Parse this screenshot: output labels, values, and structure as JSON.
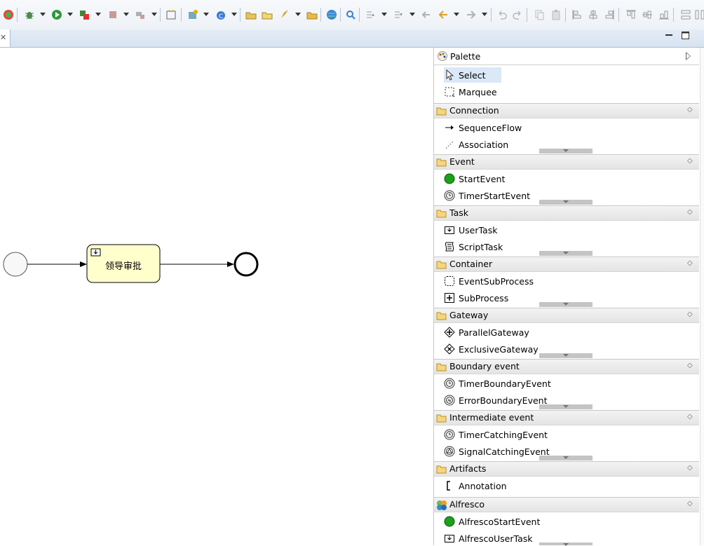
{
  "editor": {
    "close_glyph": "✕"
  },
  "diagram": {
    "user_task_label": "领导审批"
  },
  "palette": {
    "title": "Palette",
    "tools": [
      {
        "label": "Select",
        "icon": "select-arrow-icon"
      },
      {
        "label": "Marquee",
        "icon": "marquee-icon"
      }
    ],
    "drawers": [
      {
        "title": "Connection",
        "items": [
          {
            "label": "SequenceFlow",
            "icon": "sequence-flow-icon"
          },
          {
            "label": "Association",
            "icon": "association-icon"
          }
        ]
      },
      {
        "title": "Event",
        "items": [
          {
            "label": "StartEvent",
            "icon": "start-event-icon"
          },
          {
            "label": "TimerStartEvent",
            "icon": "timer-start-event-icon"
          }
        ]
      },
      {
        "title": "Task",
        "items": [
          {
            "label": "UserTask",
            "icon": "user-task-icon"
          },
          {
            "label": "ScriptTask",
            "icon": "script-task-icon"
          }
        ]
      },
      {
        "title": "Container",
        "items": [
          {
            "label": "EventSubProcess",
            "icon": "event-subprocess-icon"
          },
          {
            "label": "SubProcess",
            "icon": "subprocess-icon"
          }
        ]
      },
      {
        "title": "Gateway",
        "items": [
          {
            "label": "ParallelGateway",
            "icon": "parallel-gateway-icon"
          },
          {
            "label": "ExclusiveGateway",
            "icon": "exclusive-gateway-icon"
          }
        ]
      },
      {
        "title": "Boundary event",
        "items": [
          {
            "label": "TimerBoundaryEvent",
            "icon": "timer-boundary-event-icon"
          },
          {
            "label": "ErrorBoundaryEvent",
            "icon": "error-boundary-event-icon"
          }
        ]
      },
      {
        "title": "Intermediate event",
        "items": [
          {
            "label": "TimerCatchingEvent",
            "icon": "timer-catching-event-icon"
          },
          {
            "label": "SignalCatchingEvent",
            "icon": "signal-catching-event-icon"
          }
        ]
      },
      {
        "title": "Artifacts",
        "items": [
          {
            "label": "Annotation",
            "icon": "annotation-icon"
          }
        ]
      },
      {
        "title": "Alfresco",
        "items": [
          {
            "label": "AlfrescoStartEvent",
            "icon": "alfresco-start-event-icon"
          },
          {
            "label": "AlfrescoUserTask",
            "icon": "alfresco-user-task-icon"
          }
        ]
      }
    ]
  },
  "colors": {
    "task_fill": "#ffffcc",
    "start_event_green": "#1aa01a",
    "selection_bg": "#dbe8f7"
  }
}
